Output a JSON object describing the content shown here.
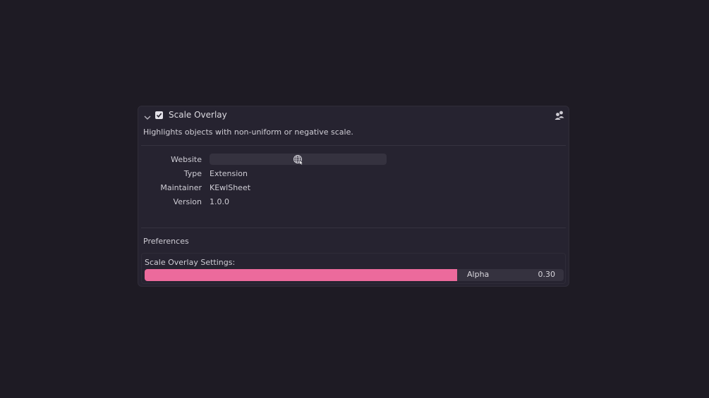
{
  "addon": {
    "name": "Scale Overlay",
    "enabled": true,
    "description": "Highlights objects with non-uniform or negative scale."
  },
  "properties": {
    "website_label": "Website",
    "type_label": "Type",
    "type_value": "Extension",
    "maintainer_label": "Maintainer",
    "maintainer_value": "KEwlSheet",
    "version_label": "Version",
    "version_value": "1.0.0"
  },
  "preferences": {
    "title": "Preferences",
    "settings_title": "Scale Overlay Settings:",
    "alpha_label": "Alpha",
    "alpha_value": "0.30",
    "alpha_slider_level": 0.746
  },
  "icons": {
    "collapse": "chevron-down-icon",
    "enabled": "checkbox-checked-icon",
    "users": "users-icon",
    "website": "globe-link-icon"
  },
  "colors": {
    "background": "#1e1b24",
    "panel": "#262330",
    "slider_fill": "#ec6a9c",
    "field": "#35323f"
  }
}
